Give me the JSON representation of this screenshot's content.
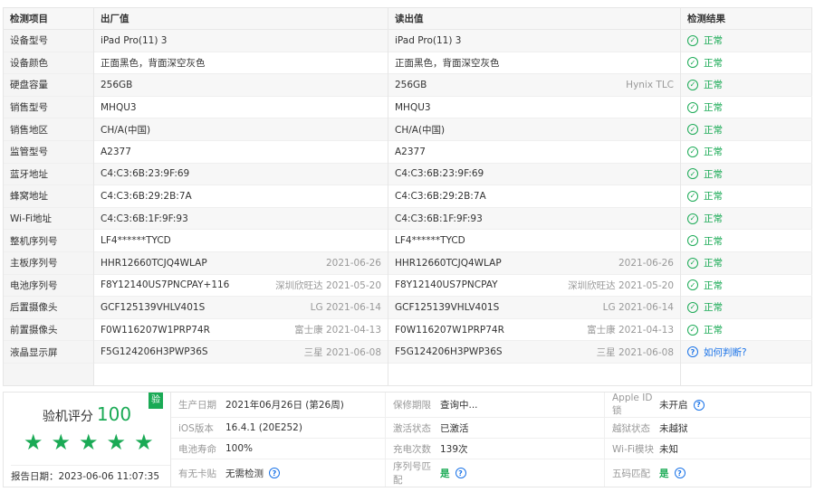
{
  "table": {
    "headers": [
      "检测项目",
      "出厂值",
      "读出值",
      "检测结果"
    ],
    "rows": [
      {
        "item": "设备型号",
        "factory": "iPad Pro(11) 3",
        "factory_meta": "",
        "read": "iPad Pro(11) 3",
        "read_meta": "",
        "result": "正常",
        "status": "ok"
      },
      {
        "item": "设备颜色",
        "factory": "正面黑色，背面深空灰色",
        "factory_meta": "",
        "read": "正面黑色，背面深空灰色",
        "read_meta": "",
        "result": "正常",
        "status": "ok"
      },
      {
        "item": "硬盘容量",
        "factory": "256GB",
        "factory_meta": "",
        "read": "256GB",
        "read_meta": "Hynix TLC",
        "result": "正常",
        "status": "ok"
      },
      {
        "item": "销售型号",
        "factory": "MHQU3",
        "factory_meta": "",
        "read": "MHQU3",
        "read_meta": "",
        "result": "正常",
        "status": "ok"
      },
      {
        "item": "销售地区",
        "factory": "CH/A(中国)",
        "factory_meta": "",
        "read": "CH/A(中国)",
        "read_meta": "",
        "result": "正常",
        "status": "ok"
      },
      {
        "item": "监管型号",
        "factory": "A2377",
        "factory_meta": "",
        "read": "A2377",
        "read_meta": "",
        "result": "正常",
        "status": "ok"
      },
      {
        "item": "蓝牙地址",
        "factory": "C4:C3:6B:23:9F:69",
        "factory_meta": "",
        "read": "C4:C3:6B:23:9F:69",
        "read_meta": "",
        "result": "正常",
        "status": "ok"
      },
      {
        "item": "蜂窝地址",
        "factory": "C4:C3:6B:29:2B:7A",
        "factory_meta": "",
        "read": "C4:C3:6B:29:2B:7A",
        "read_meta": "",
        "result": "正常",
        "status": "ok"
      },
      {
        "item": "Wi-Fi地址",
        "factory": "C4:C3:6B:1F:9F:93",
        "factory_meta": "",
        "read": "C4:C3:6B:1F:9F:93",
        "read_meta": "",
        "result": "正常",
        "status": "ok"
      },
      {
        "item": "整机序列号",
        "factory": "LF4******TYCD",
        "factory_meta": "",
        "read": "LF4******TYCD",
        "read_meta": "",
        "result": "正常",
        "status": "ok"
      },
      {
        "item": "主板序列号",
        "factory": "HHR12660TCJQ4WLAP",
        "factory_meta": "2021-06-26",
        "read": "HHR12660TCJQ4WLAP",
        "read_meta": "2021-06-26",
        "result": "正常",
        "status": "ok"
      },
      {
        "item": "电池序列号",
        "factory": "F8Y12140US7PNCPAY+116",
        "factory_meta": "深圳欣旺达 2021-05-20",
        "read": "F8Y12140US7PNCPAY",
        "read_meta": "深圳欣旺达 2021-05-20",
        "result": "正常",
        "status": "ok"
      },
      {
        "item": "后置摄像头",
        "factory": "GCF125139VHLV401S",
        "factory_meta": "LG 2021-06-14",
        "read": "GCF125139VHLV401S",
        "read_meta": "LG 2021-06-14",
        "result": "正常",
        "status": "ok"
      },
      {
        "item": "前置摄像头",
        "factory": "F0W116207W1PRP74R",
        "factory_meta": "富士康 2021-04-13",
        "read": "F0W116207W1PRP74R",
        "read_meta": "富士康 2021-04-13",
        "result": "正常",
        "status": "ok"
      },
      {
        "item": "液晶显示屏",
        "factory": "F5G124206H3PWP36S",
        "factory_meta": "三星 2021-06-08",
        "read": "F5G124206H3PWP36S",
        "read_meta": "三星 2021-06-08",
        "result": "如何判断?",
        "status": "help"
      }
    ]
  },
  "summary": {
    "score_label": "验机评分",
    "score_value": "100",
    "verify_badge": "验",
    "stars": 5,
    "report_date": "报告日期：2023-06-06 11:07:35",
    "info": [
      {
        "key": "生产日期",
        "value": "2021年06月26日 (第26周)",
        "help": false,
        "green": false
      },
      {
        "key": "保修期限",
        "value": "查询中...",
        "help": false,
        "green": false
      },
      {
        "key": "Apple ID锁",
        "value": "未开启",
        "help": true,
        "green": false
      },
      {
        "key": "iOS版本",
        "value": "16.4.1 (20E252)",
        "help": false,
        "green": false
      },
      {
        "key": "激活状态",
        "value": "已激活",
        "help": false,
        "green": false
      },
      {
        "key": "越狱状态",
        "value": "未越狱",
        "help": false,
        "green": false
      },
      {
        "key": "电池寿命",
        "value": "100%",
        "help": false,
        "green": false
      },
      {
        "key": "充电次数",
        "value": "139次",
        "help": false,
        "green": false
      },
      {
        "key": "Wi-Fi模块",
        "value": "未知",
        "help": false,
        "green": false
      },
      {
        "key": "有无卡贴",
        "value": "无需检测",
        "help": true,
        "green": false
      },
      {
        "key": "序列号匹配",
        "value": "是",
        "help": true,
        "green": true
      },
      {
        "key": "五码匹配",
        "value": "是",
        "help": true,
        "green": true
      }
    ]
  },
  "icons": {
    "ok": "check-circle-icon",
    "help": "question-circle-icon",
    "star": "star-icon"
  },
  "colors": {
    "ok": "#1aaa55",
    "help": "#1a73e8",
    "meta": "#999999"
  }
}
